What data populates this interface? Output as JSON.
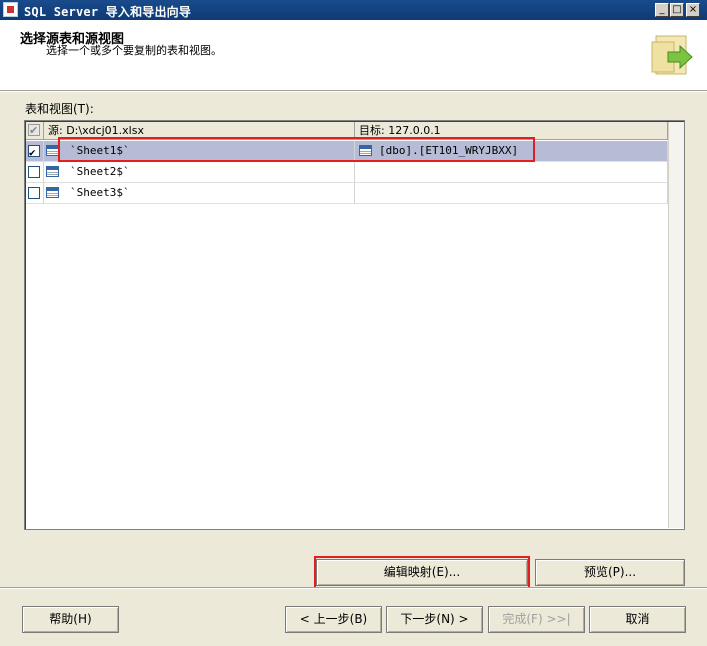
{
  "window": {
    "title": "SQL Server 导入和导出向导",
    "controls": [
      "_",
      "□",
      "×"
    ]
  },
  "header": {
    "title": "选择源表和源视图",
    "subtitle": "选择一个或多个要复制的表和视图。",
    "graphic_icon": "wizard-arrow-graphic"
  },
  "grid": {
    "label": "表和视图(T):",
    "columns": {
      "source": "源: D:\\xdcj01.xlsx",
      "destination": "目标: 127.0.0.1"
    },
    "rows": [
      {
        "checked": true,
        "source": "`Sheet1$`",
        "destination": "[dbo].[ET101_WRYJBXX]"
      },
      {
        "checked": false,
        "source": "`Sheet2$`",
        "destination": ""
      },
      {
        "checked": false,
        "source": "`Sheet3$`",
        "destination": ""
      }
    ]
  },
  "buttons": {
    "edit_mappings": "编辑映射(E)...",
    "preview": "预览(P)...",
    "help": "帮助(H)",
    "back": "< 上一步(B)",
    "next": "下一步(N) >",
    "finish": "完成(F) >>|",
    "cancel": "取消"
  },
  "colors": {
    "title_bar": "#0f3a75",
    "selected_row": "#b6bcd6",
    "highlight_box": "#e02020"
  }
}
